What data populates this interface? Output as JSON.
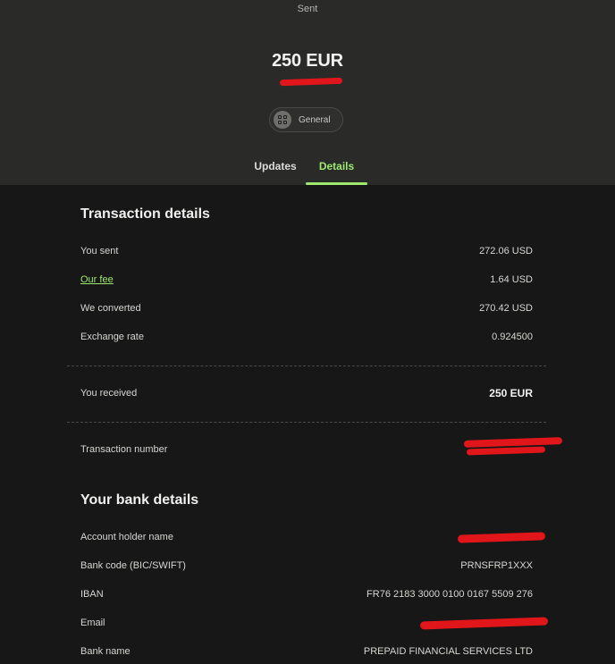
{
  "header": {
    "status": "Sent",
    "amount": "250 EUR",
    "category": "General"
  },
  "tabs": [
    {
      "label": "Updates",
      "active": false
    },
    {
      "label": "Details",
      "active": true
    }
  ],
  "transaction_details": {
    "title": "Transaction details",
    "rows": [
      {
        "label": "You sent",
        "value": "272.06 USD"
      },
      {
        "label": "Our fee",
        "value": "1.64 USD"
      },
      {
        "label": "We converted",
        "value": "270.42 USD"
      },
      {
        "label": "Exchange rate",
        "value": "0.924500"
      }
    ],
    "received": {
      "label": "You received",
      "value": "250 EUR"
    },
    "transaction_number": {
      "label": "Transaction number"
    }
  },
  "bank_details": {
    "title": "Your bank details",
    "rows": [
      {
        "label": "Account holder name"
      },
      {
        "label": "Bank code (BIC/SWIFT)",
        "value": "PRNSFRP1XXX"
      },
      {
        "label": "IBAN",
        "value": "FR76 2183 3000 0100 0167 5509 276"
      },
      {
        "label": "Email"
      },
      {
        "label": "Bank name",
        "value": "PREPAID FINANCIAL SERVICES LTD"
      }
    ]
  },
  "colors": {
    "accent": "#9fe870",
    "header_bg": "#2a2b29",
    "body_bg": "#161716",
    "redaction": "#e0161a"
  },
  "icons": {
    "category": "grid-icon"
  }
}
